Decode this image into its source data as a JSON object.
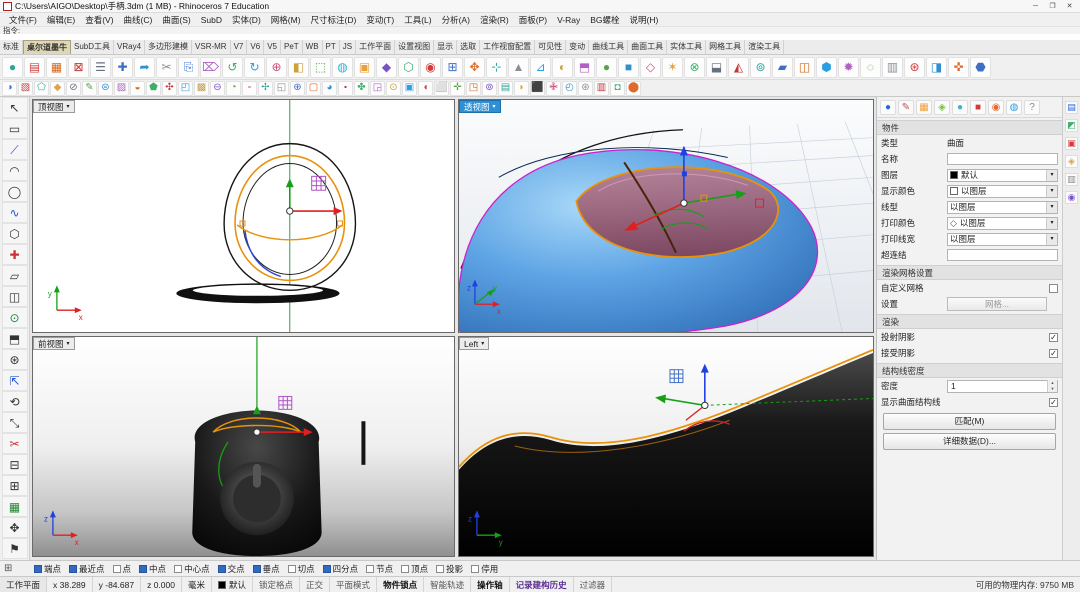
{
  "window": {
    "title": "C:\\Users\\AIGO\\Desktop\\手柄.3dm (1 MB) - Rhinoceros 7 Education",
    "controls": {
      "minimize": "─",
      "maximize": "❐",
      "close": "✕"
    }
  },
  "menu": {
    "items": [
      "文件(F)",
      "编辑(E)",
      "查看(V)",
      "曲线(C)",
      "曲面(S)",
      "SubD",
      "实体(D)",
      "网格(M)",
      "尺寸标注(D)",
      "变动(T)",
      "工具(L)",
      "分析(A)",
      "渲染(R)",
      "面板(P)",
      "V-Ray",
      "BG螺栓",
      "说明(H)"
    ]
  },
  "command": {
    "prompt": "指令:"
  },
  "tabs": {
    "items": [
      {
        "label": "标准"
      },
      {
        "label": "桌尔道墨牛",
        "active": true
      },
      {
        "label": "SubD工具"
      },
      {
        "label": "VRay4"
      },
      {
        "label": "多边形建模"
      },
      {
        "label": "VSR-MR"
      },
      {
        "label": "V7"
      },
      {
        "label": "V6"
      },
      {
        "label": "V5"
      },
      {
        "label": "PeT"
      },
      {
        "label": "WB"
      },
      {
        "label": "PT"
      },
      {
        "label": "JS"
      },
      {
        "label": "工作平面"
      },
      {
        "label": "设置视图"
      },
      {
        "label": "显示"
      },
      {
        "label": "选取"
      },
      {
        "label": "工作视窗配置"
      },
      {
        "label": "可见性"
      },
      {
        "label": "变动"
      },
      {
        "label": "曲线工具"
      },
      {
        "label": "曲面工具"
      },
      {
        "label": "实体工具"
      },
      {
        "label": "网格工具"
      },
      {
        "label": "渲染工具"
      }
    ]
  },
  "toolbars": {
    "row1": [
      {
        "g": "●",
        "c": "#2ba598"
      },
      {
        "g": "▤",
        "c": "#cc4444"
      },
      {
        "g": "▦",
        "c": "#d2691e"
      },
      {
        "g": "⊠",
        "c": "#c43535"
      },
      {
        "g": "☰",
        "c": "#667080"
      },
      {
        "g": "✚",
        "c": "#3f6fc4"
      },
      {
        "g": "➦",
        "c": "#2f8fd0"
      },
      {
        "g": "✂",
        "c": "#8a8f96"
      },
      {
        "g": "⎘",
        "c": "#4a7fd4"
      },
      {
        "g": "⌦",
        "c": "#b05fc6"
      },
      {
        "g": "↺",
        "c": "#3fae6a"
      },
      {
        "g": "↻",
        "c": "#2a9fe0"
      },
      {
        "g": "⊕",
        "c": "#d04f7e"
      },
      {
        "g": "◧",
        "c": "#caa23a"
      },
      {
        "g": "⬚",
        "c": "#57a447"
      },
      {
        "g": "◍",
        "c": "#2fb3d9"
      },
      {
        "g": "▣",
        "c": "#e8a13c"
      },
      {
        "g": "◆",
        "c": "#7a52c8"
      },
      {
        "g": "⬡",
        "c": "#3fae6a"
      },
      {
        "g": "◉",
        "c": "#d23b3b"
      },
      {
        "g": "⊞",
        "c": "#3f6fc4"
      },
      {
        "g": "✥",
        "c": "#e06a2a"
      },
      {
        "g": "⊹",
        "c": "#2ba598"
      },
      {
        "g": "▲",
        "c": "#8a8f96"
      },
      {
        "g": "⊿",
        "c": "#2a9fe0"
      },
      {
        "g": "◐",
        "c": "#caa23a"
      },
      {
        "g": "⬒",
        "c": "#b35fc6"
      },
      {
        "g": "●",
        "c": "#57a447"
      },
      {
        "g": "■",
        "c": "#2f8fd0"
      },
      {
        "g": "◇",
        "c": "#d04f7e"
      },
      {
        "g": "✶",
        "c": "#e8a13c"
      },
      {
        "g": "⊗",
        "c": "#3fae6a"
      },
      {
        "g": "⬓",
        "c": "#667080"
      },
      {
        "g": "◭",
        "c": "#c43535"
      },
      {
        "g": "⊚",
        "c": "#2ba598"
      },
      {
        "g": "▰",
        "c": "#3f6fc4"
      },
      {
        "g": "◫",
        "c": "#d2691e"
      },
      {
        "g": "⬢",
        "c": "#2a9fe0"
      },
      {
        "g": "✹",
        "c": "#b35fc6"
      },
      {
        "g": "◌",
        "c": "#57a447"
      },
      {
        "g": "▥",
        "c": "#8a8f96"
      },
      {
        "g": "⊛",
        "c": "#d23b3b"
      },
      {
        "g": "◨",
        "c": "#2f8fd0"
      },
      {
        "g": "✜",
        "c": "#e06a2a"
      },
      {
        "g": "⬣",
        "c": "#3f6fc4"
      }
    ],
    "row2": [
      {
        "g": "◑",
        "c": "#3f6fc4"
      },
      {
        "g": "▧",
        "c": "#d23b3b"
      },
      {
        "g": "⬠",
        "c": "#2ba598"
      },
      {
        "g": "◆",
        "c": "#e8a13c"
      },
      {
        "g": "⊘",
        "c": "#667080"
      },
      {
        "g": "✎",
        "c": "#57a447"
      },
      {
        "g": "⊜",
        "c": "#2f8fd0"
      },
      {
        "g": "▨",
        "c": "#b35fc6"
      },
      {
        "g": "◒",
        "c": "#d2691e"
      },
      {
        "g": "⬟",
        "c": "#3fae6a"
      },
      {
        "g": "✣",
        "c": "#c43535"
      },
      {
        "g": "◰",
        "c": "#2a9fe0"
      },
      {
        "g": "▩",
        "c": "#caa23a"
      },
      {
        "g": "⊖",
        "c": "#7a52c8"
      },
      {
        "g": "◔",
        "c": "#57a447"
      },
      {
        "g": "⬞",
        "c": "#d04f7e"
      },
      {
        "g": "✢",
        "c": "#2ba598"
      },
      {
        "g": "◱",
        "c": "#8a8f96"
      },
      {
        "g": "⊕",
        "c": "#3f6fc4"
      },
      {
        "g": "▢",
        "c": "#e06a2a"
      },
      {
        "g": "◕",
        "c": "#2f8fd0"
      },
      {
        "g": "⬝",
        "c": "#c43535"
      },
      {
        "g": "✤",
        "c": "#3fae6a"
      },
      {
        "g": "◲",
        "c": "#b35fc6"
      },
      {
        "g": "⊙",
        "c": "#caa23a"
      },
      {
        "g": "▣",
        "c": "#2a9fe0"
      },
      {
        "g": "◖",
        "c": "#d23b3b"
      },
      {
        "g": "⬜",
        "c": "#667080"
      },
      {
        "g": "✛",
        "c": "#57a447"
      },
      {
        "g": "◳",
        "c": "#d2691e"
      },
      {
        "g": "⊚",
        "c": "#7a52c8"
      },
      {
        "g": "▤",
        "c": "#2ba598"
      },
      {
        "g": "◗",
        "c": "#e8a13c"
      },
      {
        "g": "⬛",
        "c": "#3f6fc4"
      },
      {
        "g": "✙",
        "c": "#d04f7e"
      },
      {
        "g": "◴",
        "c": "#2f8fd0"
      },
      {
        "g": "⊛",
        "c": "#8a8f96"
      },
      {
        "g": "▥",
        "c": "#c43535"
      },
      {
        "g": "◘",
        "c": "#3fae6a"
      },
      {
        "g": "⬤",
        "c": "#e06a2a"
      }
    ]
  },
  "sidebar": {
    "items": [
      {
        "g": "↖",
        "c": "#333333"
      },
      {
        "g": "▭",
        "c": "#333333"
      },
      {
        "g": "⟋",
        "c": "#2255cc"
      },
      {
        "g": "◠",
        "c": "#333333"
      },
      {
        "g": "◯",
        "c": "#333333"
      },
      {
        "g": "∿",
        "c": "#2255cc"
      },
      {
        "g": "⬡",
        "c": "#333333"
      },
      {
        "g": "✚",
        "c": "#cc3333"
      },
      {
        "g": "▱",
        "c": "#333333"
      },
      {
        "g": "◫",
        "c": "#333333"
      },
      {
        "g": "⊙",
        "c": "#228833"
      },
      {
        "g": "⬒",
        "c": "#333333"
      },
      {
        "g": "⊛",
        "c": "#333333"
      },
      {
        "g": "⇱",
        "c": "#2255cc"
      },
      {
        "g": "⟲",
        "c": "#333333"
      },
      {
        "g": "⤡",
        "c": "#333333"
      },
      {
        "g": "✂",
        "c": "#cc3333"
      },
      {
        "g": "⊟",
        "c": "#333333"
      },
      {
        "g": "⊞",
        "c": "#333333"
      },
      {
        "g": "▦",
        "c": "#228833"
      },
      {
        "g": "✥",
        "c": "#333333"
      },
      {
        "g": "⚑",
        "c": "#333333"
      }
    ]
  },
  "viewports": {
    "top": {
      "label": "顶视图"
    },
    "perspective": {
      "label": "透视图"
    },
    "front": {
      "label": "前视图"
    },
    "left": {
      "label": "Left"
    }
  },
  "properties": {
    "tab_icons": [
      {
        "g": "●",
        "c": "#2a66d9"
      },
      {
        "g": "✎",
        "c": "#c0504d"
      },
      {
        "g": "▦",
        "c": "#f2a13c"
      },
      {
        "g": "◈",
        "c": "#7ac143"
      },
      {
        "g": "●",
        "c": "#3ab5c6"
      },
      {
        "g": "■",
        "c": "#d23b3b"
      },
      {
        "g": "◉",
        "c": "#e8692a"
      },
      {
        "g": "◍",
        "c": "#2a9fe0"
      },
      {
        "g": "?",
        "c": "#888888"
      }
    ],
    "section_object": "物件",
    "type_label": "类型",
    "type_value": "曲面",
    "name_label": "名称",
    "name_value": "",
    "layer_label": "图层",
    "layer_value": "默认",
    "display_color_label": "显示颜色",
    "display_color_value": "以图层",
    "linetype_label": "线型",
    "linetype_value": "以图层",
    "print_color_label": "打印颜色",
    "print_color_value": "以图层",
    "print_width_label": "打印线宽",
    "print_width_value": "以图层",
    "hyperlink_label": "超连结",
    "section_render_mesh": "渲染网格设置",
    "custom_mesh_label": "自定义网格",
    "settings_label": "设置",
    "mesh_button": "网格...",
    "section_render": "渲染",
    "cast_shadows_label": "投射阴影",
    "receive_shadows_label": "接受阴影",
    "section_isocurve": "结构线密度",
    "density_label": "密度",
    "density_value": "1",
    "show_isocurves_label": "显示曲面结构线",
    "match_button": "匹配(M)",
    "details_button": "详细数据(D)..."
  },
  "right_strip": {
    "icons": [
      {
        "g": "▤",
        "c": "#2a66d9"
      },
      {
        "g": "◩",
        "c": "#3fae6a"
      },
      {
        "g": "▣",
        "c": "#d23b3b"
      },
      {
        "g": "◈",
        "c": "#e8a13c"
      },
      {
        "g": "▥",
        "c": "#888888"
      },
      {
        "g": "◉",
        "c": "#7a52c8"
      }
    ]
  },
  "osnap": {
    "lead_icon": "⊞",
    "items": [
      {
        "label": "端点",
        "checked": true
      },
      {
        "label": "最近点",
        "checked": true
      },
      {
        "label": "点"
      },
      {
        "label": "中点",
        "checked": true
      },
      {
        "label": "中心点"
      },
      {
        "label": "交点",
        "checked": true
      },
      {
        "label": "垂点",
        "checked": true
      },
      {
        "label": "切点"
      },
      {
        "label": "四分点",
        "checked": true
      },
      {
        "label": "节点"
      },
      {
        "label": "顶点"
      },
      {
        "label": "投影"
      },
      {
        "label": "停用"
      }
    ]
  },
  "status": {
    "cplane_label": "工作平面",
    "x": "x 38.289",
    "y": "y -84.687",
    "z": "z 0.000",
    "units": "毫米",
    "layer": "默认",
    "toggles": [
      {
        "label": "锁定格点"
      },
      {
        "label": "正交"
      },
      {
        "label": "平面模式"
      },
      {
        "label": "物件锁点",
        "active": true
      },
      {
        "label": "智能轨迹"
      },
      {
        "label": "操作轴",
        "active": true
      },
      {
        "label": "记录建构历史",
        "active": true,
        "c": "#5a2d91"
      },
      {
        "label": "过滤器"
      }
    ],
    "memory": "可用的物理内存: 9750 MB"
  },
  "colors": {
    "viewport_active_label": "#2e8fd4",
    "selection_curve_orange": "#e8920a",
    "selected_surface_maroon": "#8a4a5e",
    "object_shell_blue": "#5fa5e5",
    "osnap_checked_blue": "#316ac5"
  }
}
